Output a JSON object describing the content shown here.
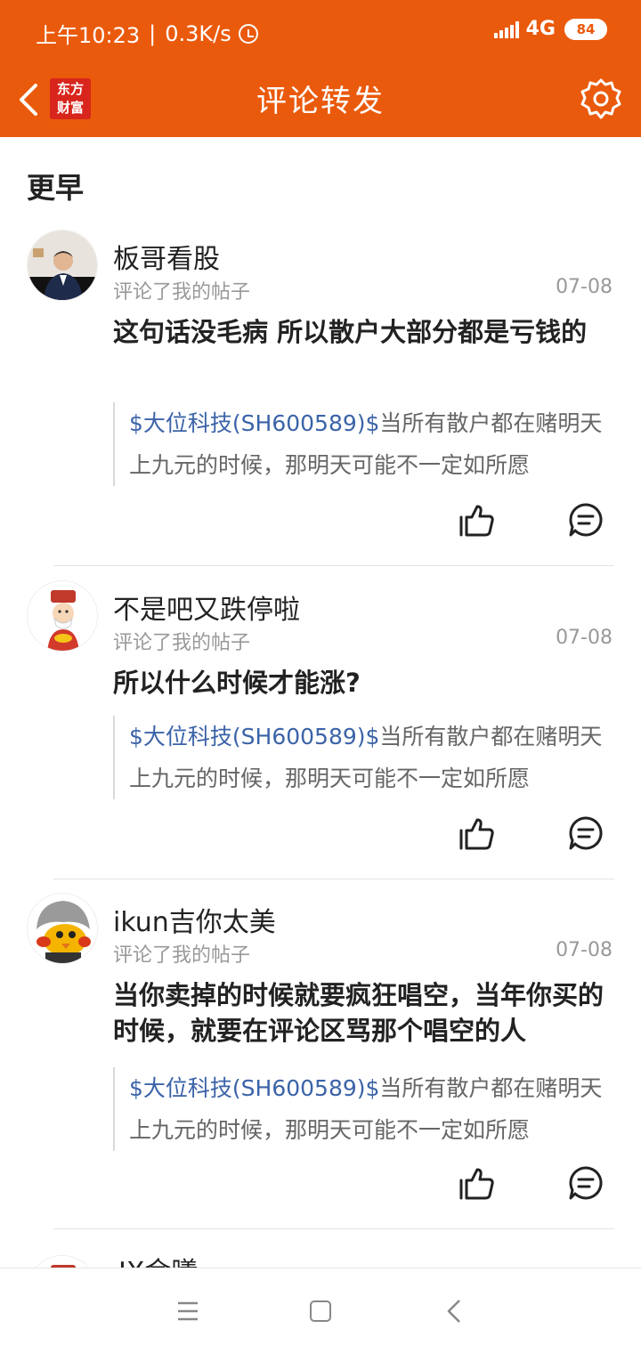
{
  "status_bar": {
    "time": "上午10:23",
    "speed": "0.3K/s",
    "network": "4G",
    "battery": "84"
  },
  "header": {
    "title": "评论转发",
    "logo_line1": "东方",
    "logo_line2": "财富"
  },
  "section_label": "更早",
  "items": [
    {
      "username": "板哥看股",
      "action": "评论了我的帖子",
      "date": "07-08",
      "comment": "这句话没毛病 所以散户大部分都是亏钱的",
      "quote_stock": "$大位科技(SH600589)$",
      "quote_text": "当所有散户都在赌明天上九元的时候，那明天可能不一定如所愿"
    },
    {
      "username": "不是吧又跌停啦",
      "action": "评论了我的帖子",
      "date": "07-08",
      "comment": "所以什么时候才能涨?",
      "quote_stock": "$大位科技(SH600589)$",
      "quote_text": "当所有散户都在赌明天上九元的时候，那明天可能不一定如所愿"
    },
    {
      "username": "ikun吉你太美",
      "action": "评论了我的帖子",
      "date": "07-08",
      "comment": "当你卖掉的时候就要疯狂唱空，当年你买的时候，就要在评论区骂那个唱空的人",
      "quote_stock": "$大位科技(SH600589)$",
      "quote_text": "当所有散户都在赌明天上九元的时候，那明天可能不一定如所愿"
    },
    {
      "username": "JX金曦"
    }
  ],
  "colors": {
    "brand": "#ea5a0c",
    "stock_link": "#3b63a8"
  }
}
